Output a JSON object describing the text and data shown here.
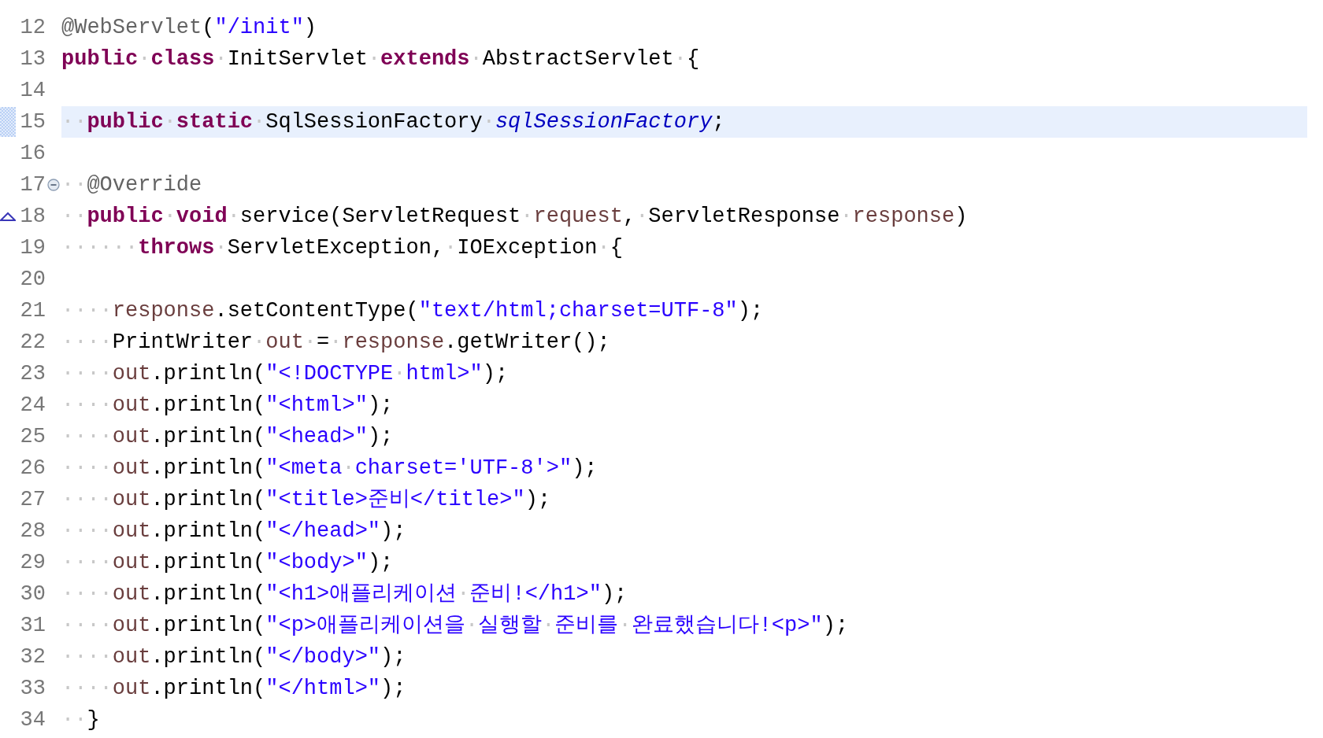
{
  "editor": {
    "lines": [
      {
        "number": "12",
        "highlighted": false,
        "tokens": [
          {
            "kind": "ann",
            "text": "@WebServlet"
          },
          {
            "kind": "plain",
            "text": "("
          },
          {
            "kind": "str",
            "text": "\"/init\""
          },
          {
            "kind": "plain",
            "text": ")"
          }
        ]
      },
      {
        "number": "13",
        "highlighted": false,
        "tokens": [
          {
            "kind": "kw",
            "text": "public"
          },
          {
            "kind": "ws",
            "text": "·"
          },
          {
            "kind": "kw",
            "text": "class"
          },
          {
            "kind": "ws",
            "text": "·"
          },
          {
            "kind": "plain",
            "text": "InitServlet"
          },
          {
            "kind": "ws",
            "text": "·"
          },
          {
            "kind": "kw",
            "text": "extends"
          },
          {
            "kind": "ws",
            "text": "·"
          },
          {
            "kind": "plain",
            "text": "AbstractServlet"
          },
          {
            "kind": "ws",
            "text": "·"
          },
          {
            "kind": "plain",
            "text": "{"
          }
        ]
      },
      {
        "number": "14",
        "highlighted": false
      },
      {
        "number": "15",
        "highlighted": true,
        "tokens": [
          {
            "kind": "ws",
            "text": "··"
          },
          {
            "kind": "kw",
            "text": "public"
          },
          {
            "kind": "ws",
            "text": "·"
          },
          {
            "kind": "kw",
            "text": "static"
          },
          {
            "kind": "ws",
            "text": "·"
          },
          {
            "kind": "plain",
            "text": "SqlSessionFactory"
          },
          {
            "kind": "ws",
            "text": "·"
          },
          {
            "kind": "field",
            "text": "sqlSessionFactory"
          },
          {
            "kind": "plain",
            "text": ";"
          }
        ]
      },
      {
        "number": "16",
        "highlighted": false
      },
      {
        "number": "17",
        "highlighted": false,
        "kind": "fold",
        "tokens": [
          {
            "kind": "ws",
            "text": "··"
          },
          {
            "kind": "ann",
            "text": "@Override"
          }
        ]
      },
      {
        "number": "18",
        "highlighted": false,
        "kind": "override",
        "tokens": [
          {
            "kind": "ws",
            "text": "··"
          },
          {
            "kind": "kw",
            "text": "public"
          },
          {
            "kind": "ws",
            "text": "·"
          },
          {
            "kind": "kw",
            "text": "void"
          },
          {
            "kind": "ws",
            "text": "·"
          },
          {
            "kind": "plain",
            "text": "service(ServletRequest"
          },
          {
            "kind": "ws",
            "text": "·"
          },
          {
            "kind": "var",
            "text": "request"
          },
          {
            "kind": "plain",
            "text": ","
          },
          {
            "kind": "ws",
            "text": "·"
          },
          {
            "kind": "plain",
            "text": "ServletResponse"
          },
          {
            "kind": "ws",
            "text": "·"
          },
          {
            "kind": "var",
            "text": "response"
          },
          {
            "kind": "plain",
            "text": ")"
          }
        ]
      },
      {
        "number": "19",
        "highlighted": false,
        "tokens": [
          {
            "kind": "ws",
            "text": "······"
          },
          {
            "kind": "kw",
            "text": "throws"
          },
          {
            "kind": "ws",
            "text": "·"
          },
          {
            "kind": "plain",
            "text": "ServletException,"
          },
          {
            "kind": "ws",
            "text": "·"
          },
          {
            "kind": "plain",
            "text": "IOException"
          },
          {
            "kind": "ws",
            "text": "·"
          },
          {
            "kind": "plain",
            "text": "{"
          }
        ]
      },
      {
        "number": "20",
        "highlighted": false
      },
      {
        "number": "21",
        "highlighted": false,
        "tokens": [
          {
            "kind": "ws",
            "text": "····"
          },
          {
            "kind": "var",
            "text": "response"
          },
          {
            "kind": "plain",
            "text": ".setContentType("
          },
          {
            "kind": "str",
            "text": "\"text/html;charset=UTF-8\""
          },
          {
            "kind": "plain",
            "text": ");"
          }
        ]
      },
      {
        "number": "22",
        "highlighted": false,
        "tokens": [
          {
            "kind": "ws",
            "text": "····"
          },
          {
            "kind": "plain",
            "text": "PrintWriter"
          },
          {
            "kind": "ws",
            "text": "·"
          },
          {
            "kind": "var",
            "text": "out"
          },
          {
            "kind": "ws",
            "text": "·"
          },
          {
            "kind": "plain",
            "text": "="
          },
          {
            "kind": "ws",
            "text": "·"
          },
          {
            "kind": "var",
            "text": "response"
          },
          {
            "kind": "plain",
            "text": ".getWriter();"
          }
        ]
      },
      {
        "number": "23",
        "highlighted": false,
        "tokens": [
          {
            "kind": "ws",
            "text": "····"
          },
          {
            "kind": "var",
            "text": "out"
          },
          {
            "kind": "plain",
            "text": ".println("
          },
          {
            "kind": "str",
            "text": "\"<!DOCTYPE"
          },
          {
            "kind": "ws",
            "text": "·"
          },
          {
            "kind": "str",
            "text": "html>\""
          },
          {
            "kind": "plain",
            "text": ");"
          }
        ]
      },
      {
        "number": "24",
        "highlighted": false,
        "tokens": [
          {
            "kind": "ws",
            "text": "····"
          },
          {
            "kind": "var",
            "text": "out"
          },
          {
            "kind": "plain",
            "text": ".println("
          },
          {
            "kind": "str",
            "text": "\"<html>\""
          },
          {
            "kind": "plain",
            "text": ");"
          }
        ]
      },
      {
        "number": "25",
        "highlighted": false,
        "tokens": [
          {
            "kind": "ws",
            "text": "····"
          },
          {
            "kind": "var",
            "text": "out"
          },
          {
            "kind": "plain",
            "text": ".println("
          },
          {
            "kind": "str",
            "text": "\"<head>\""
          },
          {
            "kind": "plain",
            "text": ");"
          }
        ]
      },
      {
        "number": "26",
        "highlighted": false,
        "tokens": [
          {
            "kind": "ws",
            "text": "····"
          },
          {
            "kind": "var",
            "text": "out"
          },
          {
            "kind": "plain",
            "text": ".println("
          },
          {
            "kind": "str",
            "text": "\"<meta"
          },
          {
            "kind": "ws",
            "text": "·"
          },
          {
            "kind": "str",
            "text": "charset='UTF-8'>\""
          },
          {
            "kind": "plain",
            "text": ");"
          }
        ]
      },
      {
        "number": "27",
        "highlighted": false,
        "tokens": [
          {
            "kind": "ws",
            "text": "····"
          },
          {
            "kind": "var",
            "text": "out"
          },
          {
            "kind": "plain",
            "text": ".println("
          },
          {
            "kind": "str",
            "text": "\"<title>준비</title>\""
          },
          {
            "kind": "plain",
            "text": ");"
          }
        ]
      },
      {
        "number": "28",
        "highlighted": false,
        "tokens": [
          {
            "kind": "ws",
            "text": "····"
          },
          {
            "kind": "var",
            "text": "out"
          },
          {
            "kind": "plain",
            "text": ".println("
          },
          {
            "kind": "str",
            "text": "\"</head>\""
          },
          {
            "kind": "plain",
            "text": ");"
          }
        ]
      },
      {
        "number": "29",
        "highlighted": false,
        "tokens": [
          {
            "kind": "ws",
            "text": "····"
          },
          {
            "kind": "var",
            "text": "out"
          },
          {
            "kind": "plain",
            "text": ".println("
          },
          {
            "kind": "str",
            "text": "\"<body>\""
          },
          {
            "kind": "plain",
            "text": ");"
          }
        ]
      },
      {
        "number": "30",
        "highlighted": false,
        "tokens": [
          {
            "kind": "ws",
            "text": "····"
          },
          {
            "kind": "var",
            "text": "out"
          },
          {
            "kind": "plain",
            "text": ".println("
          },
          {
            "kind": "str",
            "text": "\"<h1>애플리케이션"
          },
          {
            "kind": "ws",
            "text": "·"
          },
          {
            "kind": "str",
            "text": "준비!</h1>\""
          },
          {
            "kind": "plain",
            "text": ");"
          }
        ]
      },
      {
        "number": "31",
        "highlighted": false,
        "tokens": [
          {
            "kind": "ws",
            "text": "····"
          },
          {
            "kind": "var",
            "text": "out"
          },
          {
            "kind": "plain",
            "text": ".println("
          },
          {
            "kind": "str",
            "text": "\"<p>애플리케이션을"
          },
          {
            "kind": "ws",
            "text": "·"
          },
          {
            "kind": "str",
            "text": "실행할"
          },
          {
            "kind": "ws",
            "text": "·"
          },
          {
            "kind": "str",
            "text": "준비를"
          },
          {
            "kind": "ws",
            "text": "·"
          },
          {
            "kind": "str",
            "text": "완료했습니다!<p>\""
          },
          {
            "kind": "plain",
            "text": ");"
          }
        ]
      },
      {
        "number": "32",
        "highlighted": false,
        "tokens": [
          {
            "kind": "ws",
            "text": "····"
          },
          {
            "kind": "var",
            "text": "out"
          },
          {
            "kind": "plain",
            "text": ".println("
          },
          {
            "kind": "str",
            "text": "\"</body>\""
          },
          {
            "kind": "plain",
            "text": ");"
          }
        ]
      },
      {
        "number": "33",
        "highlighted": false,
        "tokens": [
          {
            "kind": "ws",
            "text": "····"
          },
          {
            "kind": "var",
            "text": "out"
          },
          {
            "kind": "plain",
            "text": ".println("
          },
          {
            "kind": "str",
            "text": "\"</html>\""
          },
          {
            "kind": "plain",
            "text": ");"
          }
        ]
      },
      {
        "number": "34",
        "highlighted": false,
        "tokens": [
          {
            "kind": "ws",
            "text": "··"
          },
          {
            "kind": "plain",
            "text": "}"
          }
        ]
      }
    ]
  }
}
